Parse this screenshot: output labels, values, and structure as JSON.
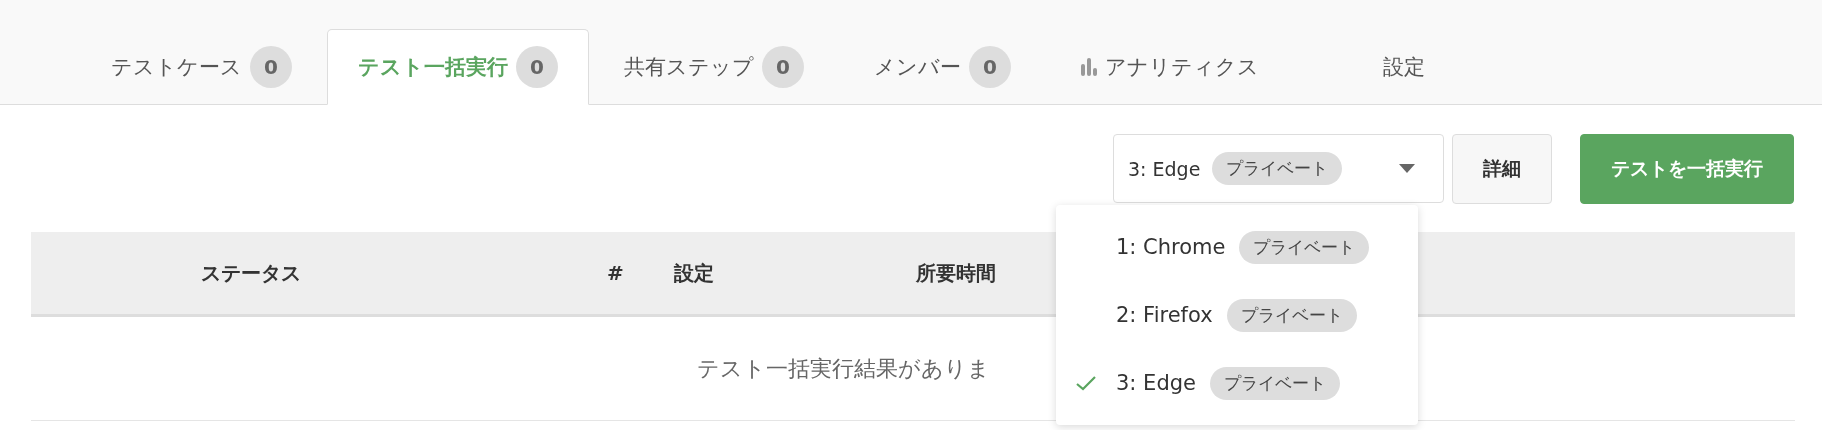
{
  "tabs": [
    {
      "kind": "count",
      "label": "テストケース",
      "count": "0",
      "selected": false
    },
    {
      "kind": "count",
      "label": "テスト一括実行",
      "count": "0",
      "selected": true
    },
    {
      "kind": "count",
      "label": "共有ステップ",
      "count": "0",
      "selected": false
    },
    {
      "kind": "count",
      "label": "メンバー",
      "count": "0",
      "selected": false
    },
    {
      "kind": "chart",
      "label": "アナリティクス",
      "selected": false
    },
    {
      "kind": "plain",
      "label": "設定",
      "selected": false
    }
  ],
  "browser_select": {
    "value": "3: Edge",
    "badge": "プライベート",
    "expanded": true,
    "options": [
      {
        "label": "1: Chrome",
        "badge": "プライベート",
        "selected": false
      },
      {
        "label": "2: Firefox",
        "badge": "プライベート",
        "selected": false
      },
      {
        "label": "3: Edge",
        "badge": "プライベート",
        "selected": true
      }
    ]
  },
  "details_button": "詳細",
  "run_button": "テストを一括実行",
  "table": {
    "columns": [
      "ステータス",
      "#",
      "設定",
      "所要時間"
    ],
    "empty_message": "テスト一括実行結果がありま"
  }
}
